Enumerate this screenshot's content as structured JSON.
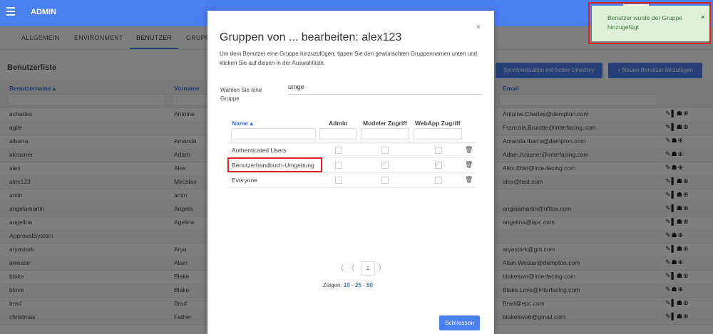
{
  "header": {
    "title": "ADMIN",
    "menu_icon": "hamburger-icon"
  },
  "tabs": [
    {
      "label": "ALLGEMEIN"
    },
    {
      "label": "ENVIRONMENT"
    },
    {
      "label": "BENUTZER",
      "active": true
    },
    {
      "label": "GRUPP"
    }
  ],
  "user_list": {
    "title": "Benutzerliste",
    "sync_button": "Synchronisation mit Active Directory",
    "add_button": "+ Neuen Benutzer hinzufügen",
    "columns": [
      "Benutzername ▴",
      "Vorname",
      "Email"
    ],
    "rows": [
      {
        "username": "acharles",
        "firstname": "Antoine",
        "email": "Antoine.Charles@dempton.com",
        "actions": "✎▌☗⊕"
      },
      {
        "username": "agile",
        "firstname": "",
        "email": "Francois.Brulotte@interfacing.com",
        "actions": "✎▌☗⊕"
      },
      {
        "username": "aibarra",
        "firstname": "Amanda",
        "email": "Amanda.Ibarra@dempton.com",
        "actions": "✎☗⊕"
      },
      {
        "username": "akrasner",
        "firstname": "Adam",
        "email": "Adam.Krasner@interfacing.com",
        "actions": "✎☗⊕"
      },
      {
        "username": "alex",
        "firstname": "Alex",
        "email": "Alex.Ebie@interfacing.com",
        "actions": "✎☗⊕"
      },
      {
        "username": "alex123",
        "firstname": "Miroslav",
        "email": "alex@test.com",
        "actions": "✎▌☗⊕"
      },
      {
        "username": "amin",
        "firstname": "amin",
        "email": "",
        "actions": "✎▌☗⊕"
      },
      {
        "username": "angelamartin",
        "firstname": "Angela",
        "email": "angelamartin@office.com",
        "actions": "✎▌☗⊕"
      },
      {
        "username": "angelina",
        "firstname": "Agelina",
        "email": "angelina@epc.com",
        "actions": "✎▌☗⊕"
      },
      {
        "username": "ApprovalSystem",
        "firstname": "",
        "email": "",
        "actions": "✎☗⊕"
      },
      {
        "username": "aryastark",
        "firstname": "Arya",
        "email": "aryastark@got.com",
        "actions": "✎▌☗⊕"
      },
      {
        "username": "awester",
        "firstname": "Alain",
        "email": "Alain.Wester@dempton.com",
        "actions": "✎☗⊕"
      },
      {
        "username": "blake",
        "firstname": "Blake",
        "email": "blakelove@interfacing.com",
        "actions": "✎▌☗⊕"
      },
      {
        "username": "blove",
        "firstname": "Blake",
        "email": "Blake.Love@interfacing.com",
        "actions": "✎☗⊕"
      },
      {
        "username": "brad",
        "firstname": "Brad",
        "email": "Brad@epc.com",
        "actions": "✎▌☗⊕"
      },
      {
        "username": "christmas",
        "firstname": "Father",
        "email": "blakelove6@gmail.com",
        "actions": "✎▌☗⊕"
      }
    ]
  },
  "toast": {
    "message": "Benutzer wurde der Gruppe hinzugefügt",
    "close": "×"
  },
  "modal": {
    "title": "Gruppen von ... bearbeiten: alex123",
    "close": "×",
    "description": "Um dem Benutzer eine Gruppe hinzuzufügen, tippen Sie den gewünschten Gruppennamen unten und klicken Sie auf diesen in der Auswahlliste.",
    "group_label": "Wählen Sie eine Gruppe",
    "group_value": "umge",
    "columns": [
      "Name ▴",
      "Admin",
      "Modeler Zugriff",
      "WebApp Zugriff"
    ],
    "rows": [
      {
        "name": "Authenticated Users",
        "admin": false,
        "modeler": false,
        "webapp": false
      },
      {
        "name": "Benutzerhandbuch-Umgebung",
        "admin": false,
        "modeler": true,
        "webapp": true
      },
      {
        "name": "Everyone",
        "admin": false,
        "modeler": false,
        "webapp": false
      }
    ],
    "pager": {
      "first": "⟨",
      "prev": "⟨",
      "page": "1",
      "next": "⟩"
    },
    "show_label": "Zeigen:",
    "show_options": [
      "10",
      "25",
      "50"
    ],
    "show_sep": "-",
    "close_button": "Schliessen"
  },
  "colors": {
    "primary": "#4a7ff0",
    "toast_bg": "#dff0d8",
    "highlight": "#e0201b"
  }
}
